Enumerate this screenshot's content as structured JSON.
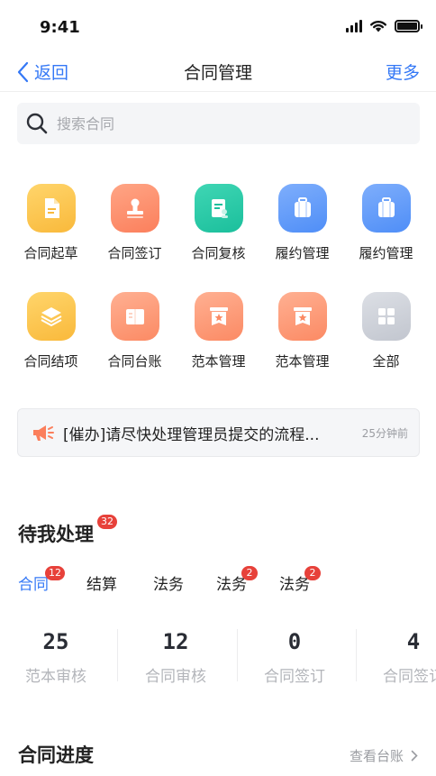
{
  "status_bar": {
    "time": "9:41"
  },
  "nav": {
    "back_label": "返回",
    "title": "合同管理",
    "more_label": "更多"
  },
  "search": {
    "placeholder": "搜索合同"
  },
  "apps": [
    {
      "label": "合同起草",
      "icon": "document-icon",
      "color": "#f9b93b"
    },
    {
      "label": "合同签订",
      "icon": "stamp-icon",
      "color": "#fb7f5c"
    },
    {
      "label": "合同复核",
      "icon": "review-icon",
      "color": "#1bbf9c"
    },
    {
      "label": "履约管理",
      "icon": "suitcase-icon",
      "color": "#4f8ef7"
    },
    {
      "label": "履约管理",
      "icon": "suitcase-icon",
      "color": "#4f8ef7"
    },
    {
      "label": "合同结项",
      "icon": "layers-icon",
      "color": "#f9b93b"
    },
    {
      "label": "合同台账",
      "icon": "book-icon",
      "color": "#fb8a64"
    },
    {
      "label": "范本管理",
      "icon": "template-star-icon",
      "color": "#fb8a64"
    },
    {
      "label": "范本管理",
      "icon": "template-star-icon",
      "color": "#fb8a64"
    },
    {
      "label": "全部",
      "icon": "grid-icon",
      "color": "#c2c6cf"
    }
  ],
  "notice": {
    "text": "[催办]请尽快处理管理员提交的流程...",
    "time": "25分钟前"
  },
  "pending": {
    "title": "待我处理",
    "badge": "32",
    "tabs": [
      {
        "label": "合同",
        "badge": "12",
        "active": true
      },
      {
        "label": "结算",
        "badge": ""
      },
      {
        "label": "法务",
        "badge": ""
      },
      {
        "label": "法务",
        "badge": "2"
      },
      {
        "label": "法务",
        "badge": "2"
      }
    ],
    "stats": [
      {
        "value": "25",
        "label": "范本审核"
      },
      {
        "value": "12",
        "label": "合同审核"
      },
      {
        "value": "0",
        "label": "合同签订"
      },
      {
        "value": "4",
        "label": "合同签订"
      }
    ]
  },
  "progress": {
    "title": "合同进度",
    "link_label": "查看台账"
  },
  "colors": {
    "accent": "#3478f6",
    "badge": "#e7413a"
  }
}
